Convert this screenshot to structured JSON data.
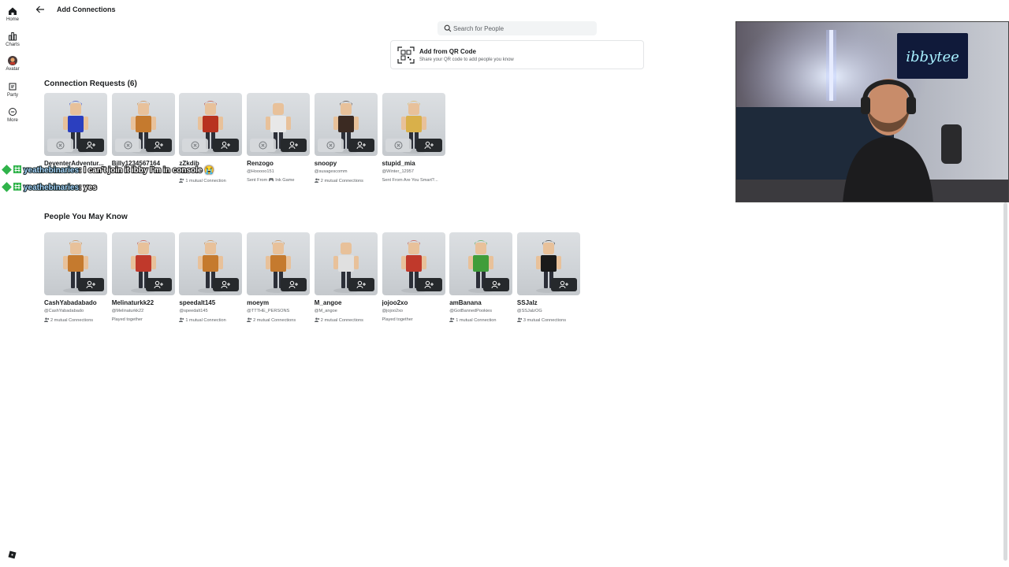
{
  "nav": {
    "items": [
      {
        "label": "Home",
        "icon": "home-icon"
      },
      {
        "label": "Charts",
        "icon": "charts-icon"
      },
      {
        "label": "Avatar",
        "icon": "avatar-icon"
      },
      {
        "label": "Party",
        "icon": "party-icon"
      },
      {
        "label": "More",
        "icon": "more-icon"
      }
    ]
  },
  "header": {
    "title": "Add Connections"
  },
  "search": {
    "placeholder": "Search for People"
  },
  "qr": {
    "title": "Add from QR Code",
    "subtitle": "Share your QR code to add people you know"
  },
  "requests": {
    "title": "Connection Requests (6)",
    "cards": [
      {
        "name": "DeventerAdventur...",
        "handle": "",
        "meta": "",
        "avatar_color": "#2b3fbf"
      },
      {
        "name": "Billy1234567164",
        "handle": "",
        "meta": "",
        "avatar_color": "#c57a2e"
      },
      {
        "name": "zZkdib",
        "handle": "",
        "meta": "1 mutual Connection",
        "avatar_color": "#b8331f"
      },
      {
        "name": "Renzogo",
        "handle": "@Hooooo151",
        "meta": "Sent From 🎮 Ink Game",
        "avatar_color": "#e8e8e8"
      },
      {
        "name": "snoopy",
        "handle": "@susagescomm",
        "meta": "2 mutual Connections",
        "avatar_color": "#3b2a22"
      },
      {
        "name": "stupid_mia",
        "handle": "@Winter_12957",
        "meta": "Sent From Are You Smart?...",
        "avatar_color": "#d9b04a"
      }
    ]
  },
  "people": {
    "title": "People You May Know",
    "cards": [
      {
        "name": "CashYabadabado",
        "handle": "@CashYabadabado",
        "meta": "2 mutual Connections",
        "avatar_color": "#c57a2e"
      },
      {
        "name": "Melinaturkk22",
        "handle": "@Melinaturkk22",
        "meta": "Played together",
        "avatar_color": "#c0392b"
      },
      {
        "name": "speedalt145",
        "handle": "@speedalt145",
        "meta": "1 mutual Connection",
        "avatar_color": "#c57a2e"
      },
      {
        "name": "moeym",
        "handle": "@TTTHE_PERSONS",
        "meta": "2 mutual Connections",
        "avatar_color": "#c57a2e"
      },
      {
        "name": "M_angoe",
        "handle": "@M_angoe",
        "meta": "2 mutual Connections",
        "avatar_color": "#e0e0e0"
      },
      {
        "name": "jojoo2xo",
        "handle": "@jojoo2xo",
        "meta": "Played together",
        "avatar_color": "#c0392b"
      },
      {
        "name": "amBanana",
        "handle": "@GotBannedPookies",
        "meta": "1 mutual Connection",
        "avatar_color": "#3f9d3a"
      },
      {
        "name": "SSJalz",
        "handle": "@SSJalzOG",
        "meta": "3 mutual Connections",
        "avatar_color": "#1a1a1a"
      }
    ]
  },
  "chat": [
    {
      "user": "yeathebinaries",
      "message": ": I can't join it ibby I'm in console 😭"
    },
    {
      "user": "yeathebinaries",
      "message": ": yes"
    }
  ],
  "webcam": {
    "neon_sign": "ibbytee"
  },
  "colors": {
    "add_button": "#26292c",
    "decline_button": "#d7dadd",
    "chat_badge": "#2fb34a"
  }
}
